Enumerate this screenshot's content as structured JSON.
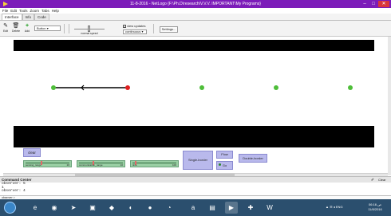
{
  "window": {
    "title": "11-8-2016 - NetLogo {F:\\Ph.D\\research\\V.V.V. IMPORTANT\\My Programs}",
    "minimize_glyph": "–",
    "maximize_glyph": "□",
    "close_glyph": "✕",
    "accent_color": "#7c1cb9"
  },
  "menubar": {
    "items": [
      "File",
      "Edit",
      "Tools",
      "Zoom",
      "Tabs",
      "Help"
    ]
  },
  "tabs": [
    "Interface",
    "Info",
    "Code"
  ],
  "toolbar": {
    "edit_label": "Edit",
    "delete_label": "Delete",
    "add_label": "Add",
    "widget_type": "Button",
    "speed_label": "normal speed",
    "view_updates_label": "view updates",
    "update_mode": "continuous",
    "settings_label": "Settings..."
  },
  "world": {
    "background": "#000000",
    "band_color": "#ffffff",
    "node_colors": {
      "source": "#4fbe3a",
      "relay": "#e02020",
      "idle": "#4fbe3a"
    }
  },
  "controls": {
    "clear_label": "clear",
    "sliders": [
      {
        "name": "sensing_range",
        "value": "20",
        "fraction": 0.35
      },
      {
        "name": "communication_range",
        "value": "10",
        "fraction": 0.3
      },
      {
        "name": "time",
        "value": "100",
        "fraction": 0.05
      }
    ],
    "single_border_label": "Single-border",
    "flow_label": "Flow",
    "go_label": "Go",
    "double_border_label": "Double-border"
  },
  "command_center": {
    "title": "Command Center",
    "clear_label": "Clear",
    "output": [
      "observer: 5",
      "1",
      "observer: 4"
    ],
    "prompt": "observer >"
  },
  "taskbar": {
    "apps": [
      "e",
      "◉",
      "➤",
      "▣",
      "◆",
      "◐",
      "●",
      "◔",
      "a",
      "▤",
      "▶",
      "✚",
      "W"
    ],
    "tray_text": "▲ ☰ ◂ ENG",
    "time": "06:16 ص",
    "date": "11/8/2016"
  }
}
